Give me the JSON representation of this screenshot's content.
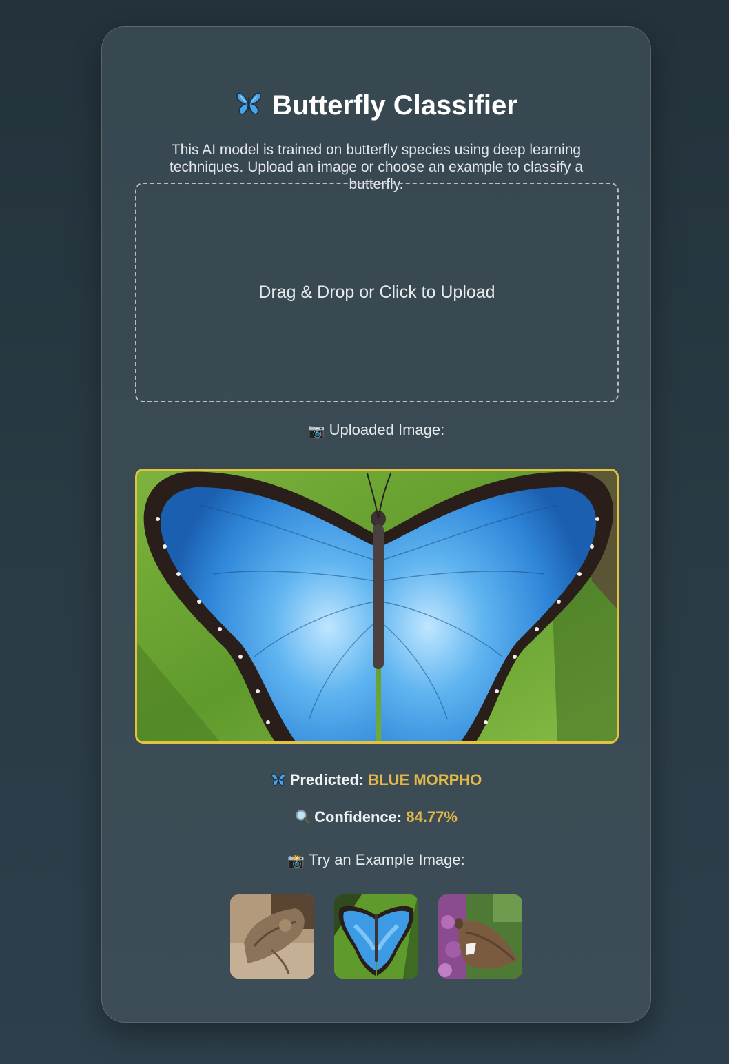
{
  "header": {
    "title": "Butterfly Classifier",
    "title_icon": "butterfly-icon",
    "description": "This AI model is trained on butterfly species using deep learning techniques. Upload an image or choose an example to classify a butterfly."
  },
  "upload": {
    "prompt": "Drag & Drop or Click to Upload"
  },
  "uploaded": {
    "label": "Uploaded Image:",
    "label_icon": "camera-icon",
    "image_subject": "blue morpho butterfly on green leaf"
  },
  "prediction": {
    "label": "Predicted:",
    "value": "BLUE MORPHO",
    "icon": "butterfly-icon"
  },
  "confidence": {
    "label": "Confidence:",
    "value": "84.77%",
    "icon": "magnifier-icon"
  },
  "examples": {
    "label": "Try an Example Image:",
    "label_icon": "camera-flash-icon",
    "items": [
      {
        "subject": "brown moth on sandy ground"
      },
      {
        "subject": "blue morpho butterfly"
      },
      {
        "subject": "brown skipper on flowers"
      }
    ]
  },
  "colors": {
    "background": "#263540",
    "card": "#3a4a53",
    "accent": "#e2b84a",
    "preview_border": "#e3c23f",
    "text": "#e8ecef"
  }
}
